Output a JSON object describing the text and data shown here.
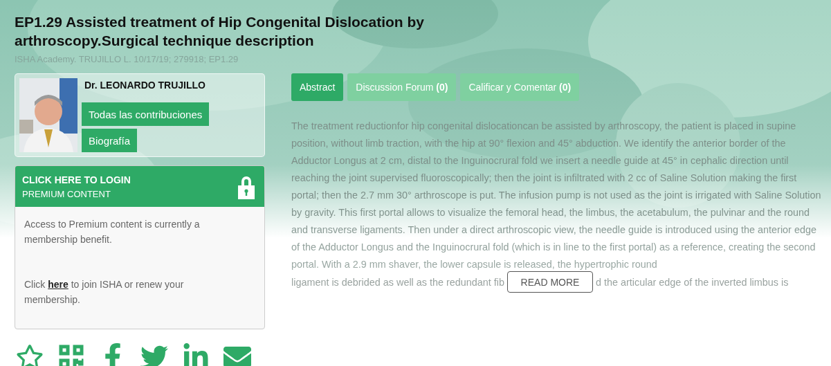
{
  "title": "EP1.29 Assisted treatment of Hip Congenital Dislocation by arthroscopy.Surgical technique description",
  "meta": "ISHA Academy. TRUJILLO L. 10/17/19; 279918; EP1.29",
  "author": {
    "photo": {
      "kind": "picture"
    },
    "name": "Dr. LEONARDO TRUJILLO",
    "buttons": [
      "Todas las contribuciones",
      "Biografía"
    ]
  },
  "login": {
    "title": "CLICK HERE TO LOGIN",
    "subtitle": "PREMIUM CONTENT",
    "paragraphs": [
      {
        "text": "Access to Premium content is currently a membership benefit."
      },
      {
        "before": "Click",
        "link": "here",
        "after": "to join ISHA or renew your membership."
      }
    ]
  },
  "share_icons": [
    {
      "kind": "star"
    },
    {
      "kind": "qr"
    },
    {
      "kind": "facebook"
    },
    {
      "kind": "twitter"
    },
    {
      "kind": "linkedin"
    },
    {
      "kind": "email"
    }
  ],
  "tabs": [
    {
      "label": "Abstract",
      "selected": true
    },
    {
      "label": "Discussion Forum **(0)**",
      "selected": false
    },
    {
      "label": "Calificar y Comentar **(0)**",
      "selected": false
    }
  ],
  "abstract": {
    "text": "The treatment reductionfor hip congenital dislocationcan be assisted by arthroscopy, the patient is placed in supine position, without limb traction, with the hip at 90° flexion and 45° abduction. We identify the anterior border of the Adductor Longus at 2 cm, distal to the Inguinocrural fold we insert a needle guide at 45° in cephalic direction until reaching the joint supervised fluoroscopically; then the joint is infiltrated with 2 cc of Saline Solution making the first portal; then the 2.7 mm 30° arthroscope is put. The infusion pump is not used as the joint is irrigated with Saline Solution by gravity. This first portal allows to visualize the femoral head, the limbus, the acetabulum, the pulvinar and the round and transverse ligaments. Then under a direct arthroscopic view, the needle guide is introduced using the anterior edge of the Adductor Longus and the Inguinocrural fold (which is in line to the first portal) as a reference, creating the second portal. With a 2.9 mm shaver, the lower capsule is released, the hypertrophic round",
    "last_line_left": "ligament is debrided as well as the redundant fib",
    "last_line_right": "d the articular edge of the inverted limbus is",
    "read_more": "READ MORE"
  }
}
